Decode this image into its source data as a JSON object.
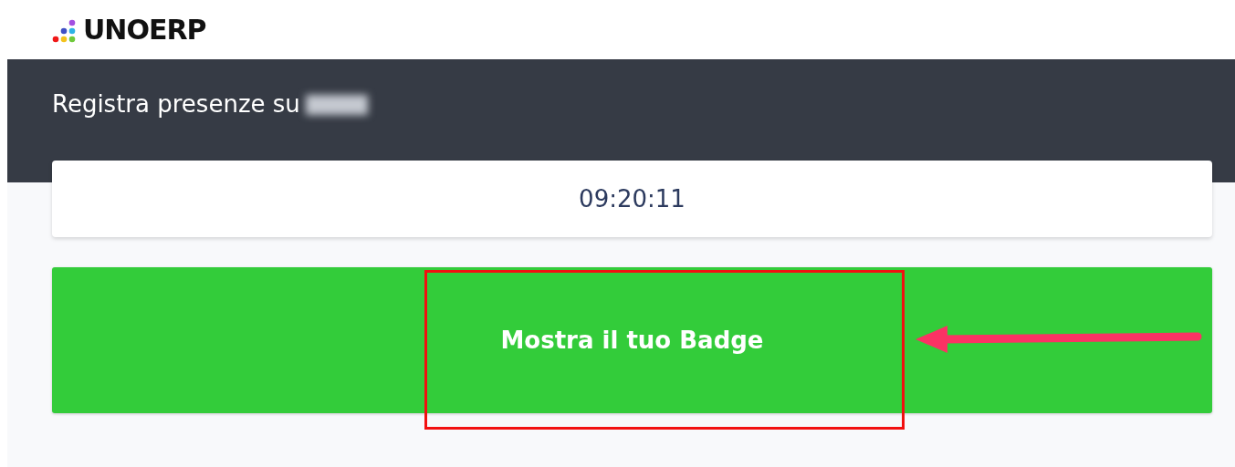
{
  "logo": {
    "text": "UNOERP"
  },
  "header": {
    "title": "Registra presenze su"
  },
  "clock": {
    "time": "09:20:11"
  },
  "badge_button": {
    "label": "Mostra il tuo Badge"
  }
}
